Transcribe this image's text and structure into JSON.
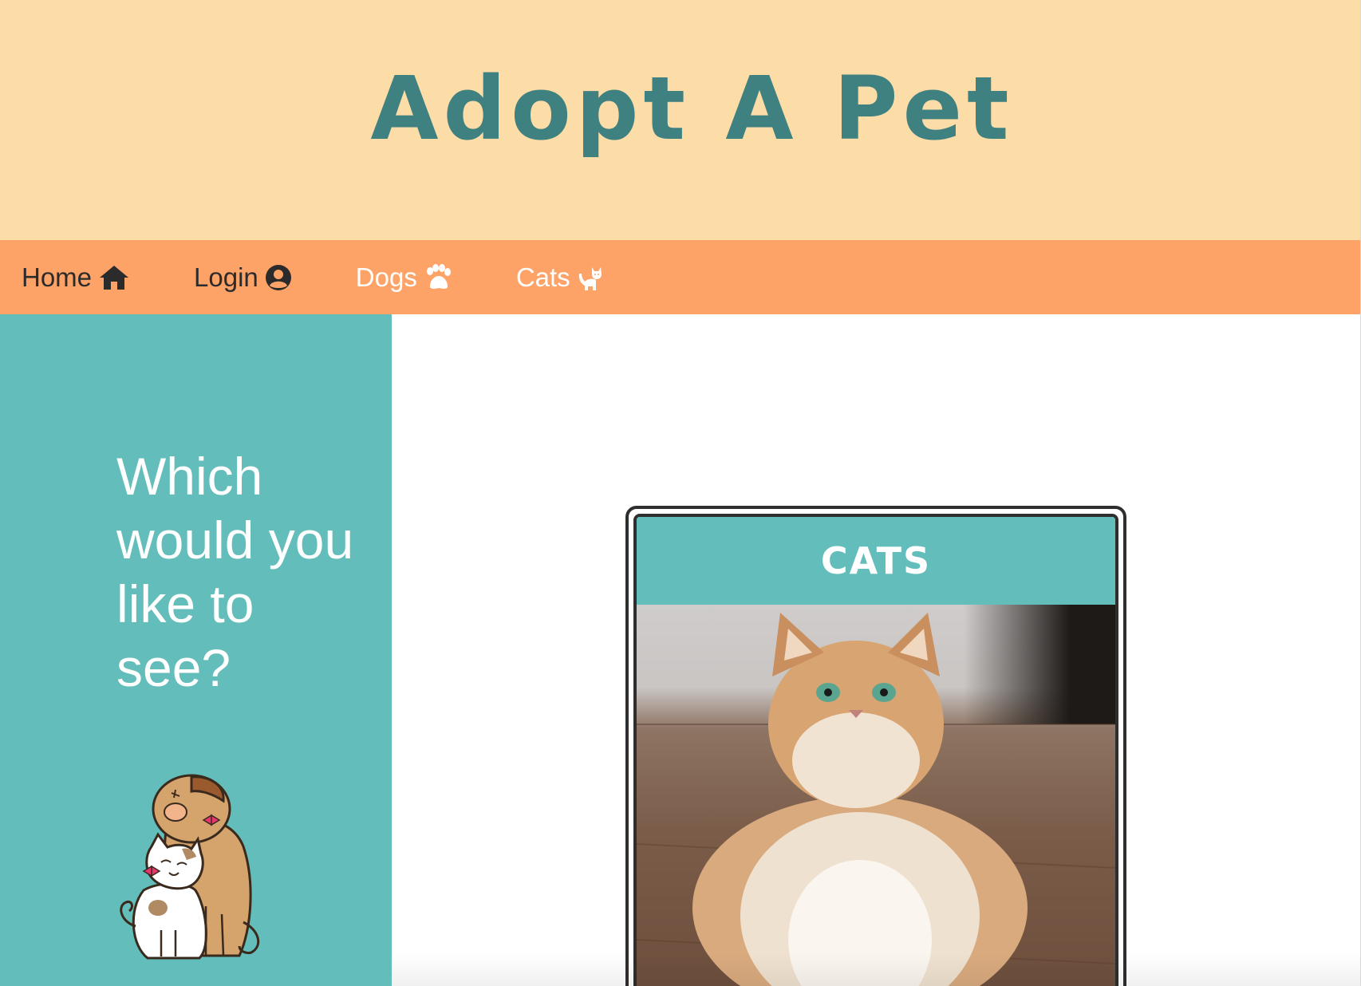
{
  "header": {
    "title": "Adopt A Pet"
  },
  "nav": {
    "items": [
      {
        "label": "Home",
        "icon": "home-icon"
      },
      {
        "label": "Login",
        "icon": "user-circle-icon"
      },
      {
        "label": "Dogs",
        "icon": "paw-icon"
      },
      {
        "label": "Cats",
        "icon": "cat-icon"
      }
    ]
  },
  "sidebar": {
    "question": "Which would you like to see?",
    "illustration": "dog-and-cat-hug-illustration"
  },
  "card": {
    "title": "CATS",
    "image": "fluffy-cat-photo"
  },
  "colors": {
    "header_bg": "#fcdca7",
    "title_color": "#3f8080",
    "nav_bg": "#fea367",
    "sidebar_bg": "#63bdba",
    "card_header_bg": "#63bdba"
  }
}
